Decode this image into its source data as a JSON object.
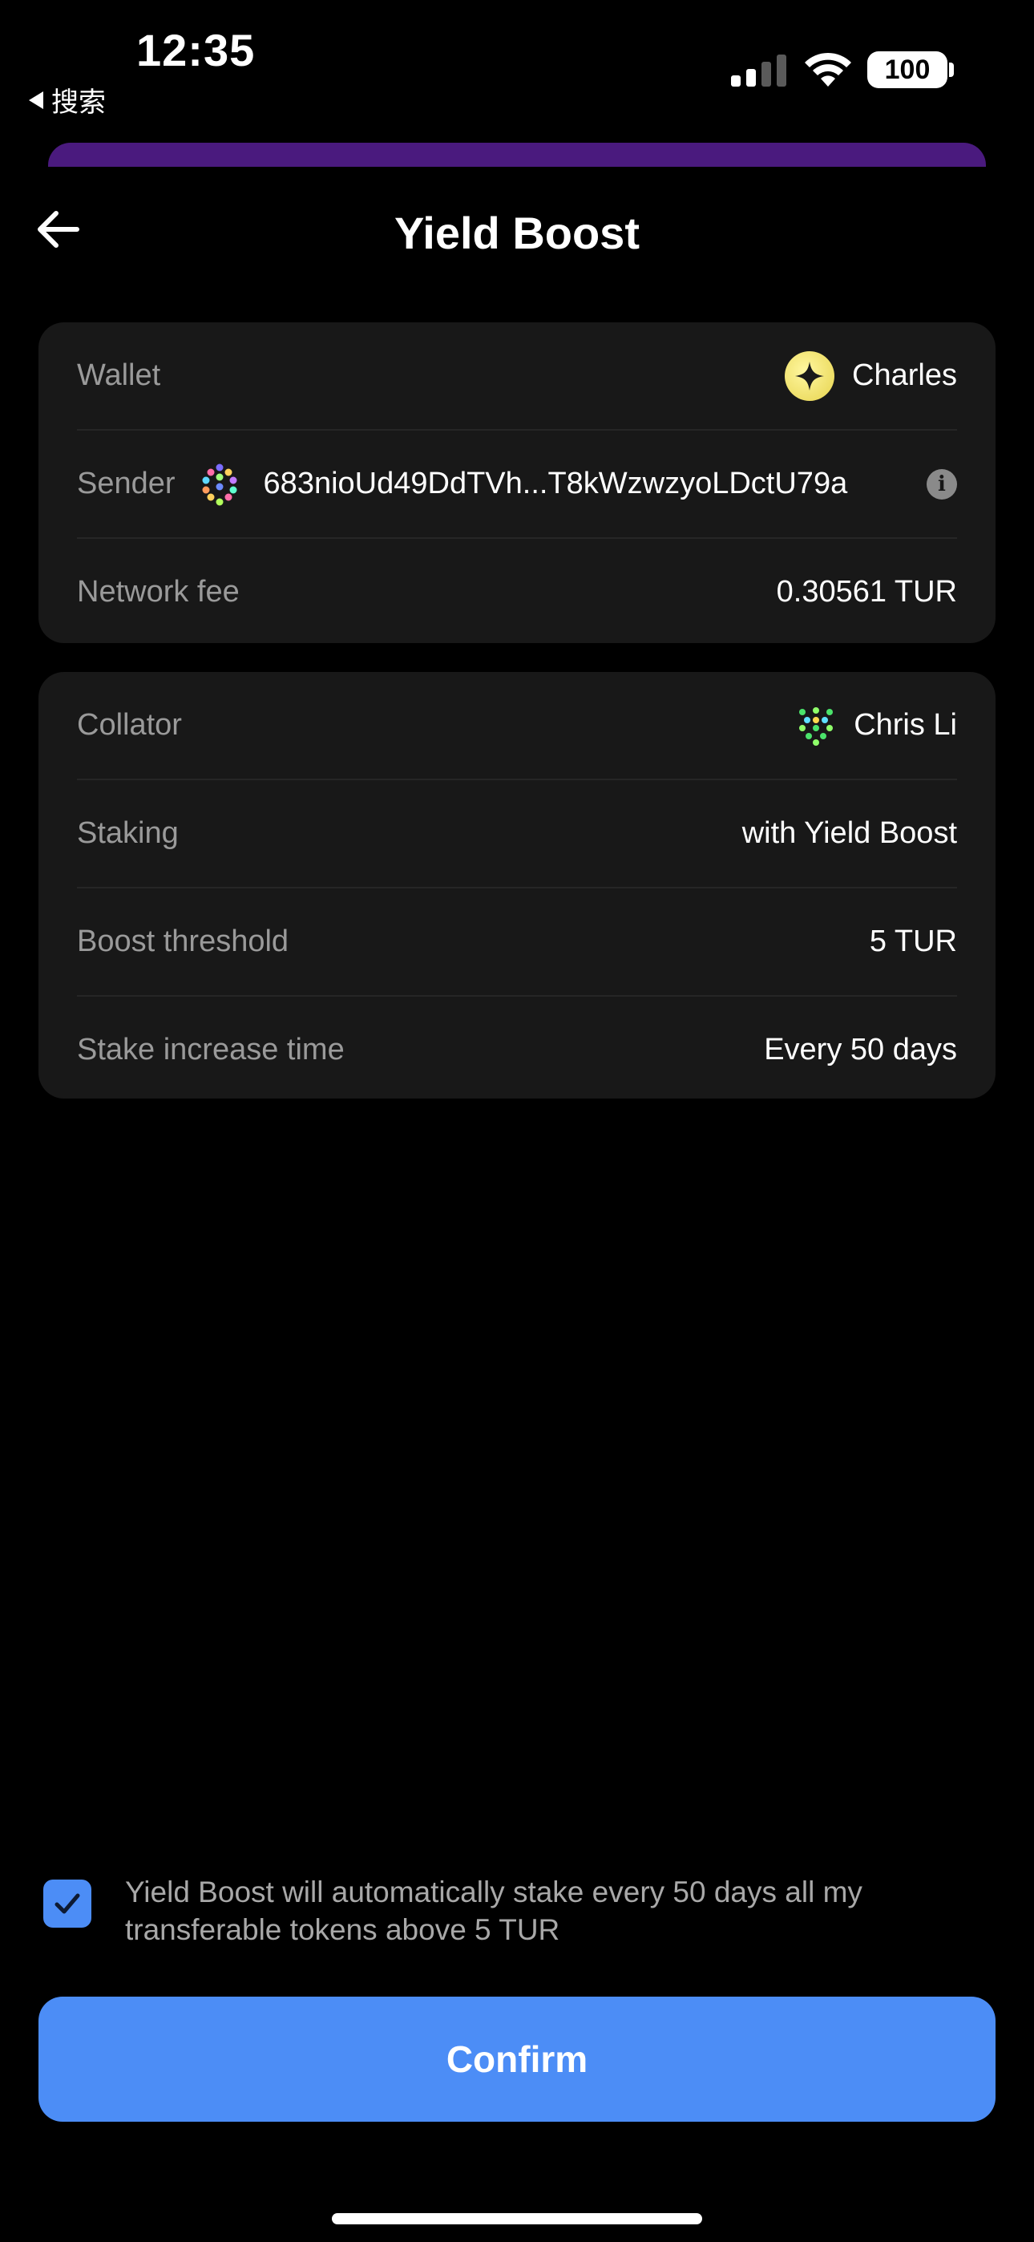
{
  "status_bar": {
    "time": "12:35",
    "back_label": "搜索",
    "battery": "100"
  },
  "header": {
    "title": "Yield Boost"
  },
  "card_wallet": {
    "wallet_label": "Wallet",
    "wallet_name": "Charles",
    "sender_label": "Sender",
    "sender_address": "683nioUd49DdTVh...T8kWzwzyoLDctU79a",
    "fee_label": "Network fee",
    "fee_value": "0.30561 TUR"
  },
  "card_staking": {
    "collator_label": "Collator",
    "collator_name": "Chris Li",
    "staking_label": "Staking",
    "staking_value": "with Yield Boost",
    "threshold_label": "Boost threshold",
    "threshold_value": "5 TUR",
    "time_label": "Stake increase time",
    "time_value": "Every 50 days"
  },
  "agreement": {
    "checked": true,
    "text": "Yield Boost will automatically stake every 50 days all my transferable tokens above 5 TUR"
  },
  "actions": {
    "confirm_label": "Confirm"
  },
  "colors": {
    "accent": "#4c8df6",
    "card": "#181818",
    "sheet_edge": "#4a1a7e"
  }
}
